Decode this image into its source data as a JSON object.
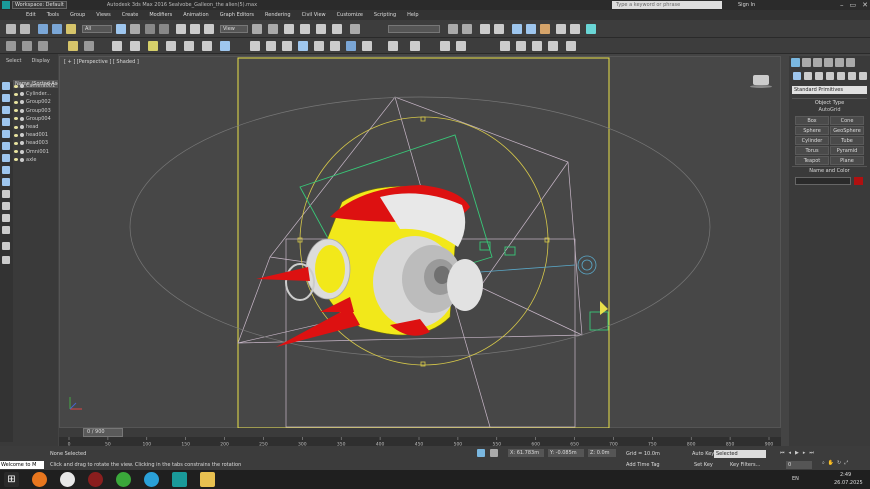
{
  "titlebar": {
    "workspace": "Workspace: Default",
    "title": "Autodesk 3ds Max 2016    Sealvobe_Galleon_the alien(5).max",
    "search_placeholder": "Type a keyword or phrase",
    "signin": "Sign In"
  },
  "menu": [
    "Edit",
    "Tools",
    "Group",
    "Views",
    "Create",
    "Modifiers",
    "Animation",
    "Graph Editors",
    "Rendering",
    "Civil View",
    "Customize",
    "Scripting",
    "Help"
  ],
  "toolbar": {
    "selection_filter": "All",
    "view_dropdown": "View",
    "named_selection": ""
  },
  "scene_explorer": {
    "tabs": [
      "Select",
      "Display"
    ],
    "header": "Name (Sorted Ascending)",
    "items": [
      "Camera001",
      "Cylinder...",
      "Group002",
      "Group003",
      "Group004",
      "head",
      "head001",
      "head003",
      "Omni001",
      "axle"
    ]
  },
  "viewport": {
    "label": "[ + ] [Perspective ] [ Shaded ]"
  },
  "command_panel": {
    "category": "Standard Primitives",
    "object_type_title": "Object Type",
    "autogrid": "AutoGrid",
    "buttons": [
      "Box",
      "Cone",
      "Sphere",
      "GeoSphere",
      "Cylinder",
      "Tube",
      "Torus",
      "Pyramid",
      "Teapot",
      "Plane"
    ],
    "name_color_title": "Name and Color",
    "object_color": "#b01010"
  },
  "timeline": {
    "frame_indicator": "0 / 900",
    "ticks": [
      "0",
      "50",
      "100",
      "150",
      "200",
      "250",
      "300",
      "350",
      "400",
      "450",
      "500",
      "550",
      "600",
      "650",
      "700",
      "750",
      "800",
      "850",
      "900"
    ]
  },
  "status": {
    "selection": "None Selected",
    "prompt": "Click and drag to rotate the view.  Clicking in the tabs constrains the rotation",
    "x": "X: 61.783m",
    "y": "Y: -0.085m",
    "z": "Z: 0.0m",
    "grid": "Grid = 10.0m",
    "add_time_tag": "Add Time Tag",
    "autokey": "Auto Key",
    "setkey": "Set Key",
    "key_mode": "Selected",
    "key_filters": "Key Filters...",
    "frame": "0",
    "welcome": "Welcome to M"
  },
  "taskbar": {
    "lang": "EN",
    "time": "2:49",
    "date": "26.07.2025"
  },
  "colors": {
    "viewport_bg": "#474747",
    "selection_yellow": "#e8e04a",
    "model_red": "#dd1111",
    "model_yellow": "#f2e81a",
    "camera_wire": "#c8b7c8",
    "helper_green": "#38c878"
  }
}
